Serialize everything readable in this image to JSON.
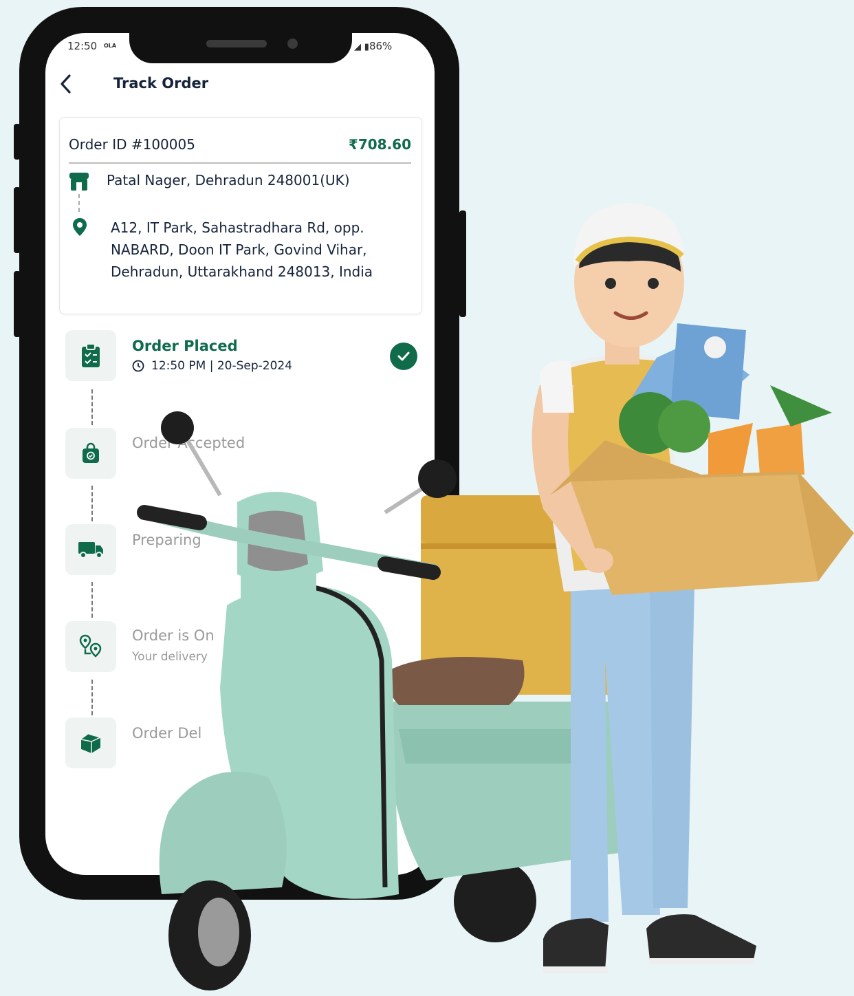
{
  "status_bar": {
    "time": "12:50",
    "carrier": "OLA",
    "battery": "86%"
  },
  "header": {
    "title": "Track Order",
    "back_icon": "chevron-left-icon"
  },
  "order": {
    "id_label": "Order ID #100005",
    "price": "₹708.60",
    "from_address": "Patal Nager, Dehradun 248001(UK)",
    "to_address": "A12, IT Park, Sahastradhara Rd, opp. NABARD, Doon IT Park, Govind Vihar, Dehradun, Uttarakhand 248013, India"
  },
  "steps": [
    {
      "title": "Order Placed",
      "time": "12:50 PM | 20-Sep-2024",
      "done": true,
      "icon": "clipboard-icon"
    },
    {
      "title": "Order Accepted",
      "icon": "bag-icon"
    },
    {
      "title": "Preparing",
      "icon": "truck-icon"
    },
    {
      "title": "Order is On",
      "sub": "Your delivery",
      "icon": "route-icon"
    },
    {
      "title": "Order Del",
      "icon": "box-icon"
    }
  ],
  "colors": {
    "accent": "#0f6b4a",
    "background": "#e8f4f5",
    "text": "#15233b"
  }
}
